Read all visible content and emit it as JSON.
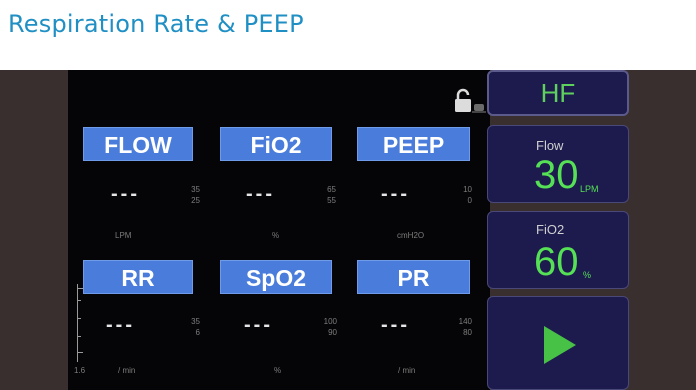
{
  "page_title": "Respiration Rate & PEEP",
  "parameters": [
    {
      "label": "FLOW",
      "value": "---",
      "upper_limit": "35",
      "lower_limit": "25",
      "unit": "LPM"
    },
    {
      "label": "FiO2",
      "value": "---",
      "upper_limit": "65",
      "lower_limit": "55",
      "unit": "%"
    },
    {
      "label": "PEEP",
      "value": "---",
      "upper_limit": "10",
      "lower_limit": "0",
      "unit": "cmH2O"
    },
    {
      "label": "RR",
      "value": "---",
      "upper_limit": "35",
      "lower_limit": "6",
      "unit": "/ min"
    },
    {
      "label": "SpO2",
      "value": "---",
      "upper_limit": "100",
      "lower_limit": "90",
      "unit": "%"
    },
    {
      "label": "PR",
      "value": "---",
      "upper_limit": "140",
      "lower_limit": "80",
      "unit": "/ min"
    }
  ],
  "scale_label": "1.6",
  "side_panel": {
    "mode": "HF",
    "flow": {
      "name": "Flow",
      "value": "30",
      "unit": "LPM"
    },
    "fio2": {
      "name": "FiO2",
      "value": "60",
      "unit": "%"
    }
  },
  "icons": {
    "lock": "lock-icon",
    "play": "play-icon"
  },
  "colors": {
    "label_bg": "#4a7ddb",
    "accent_green": "#55e055",
    "panel_bg": "#1d1b4d",
    "title": "#1f8fc4"
  }
}
